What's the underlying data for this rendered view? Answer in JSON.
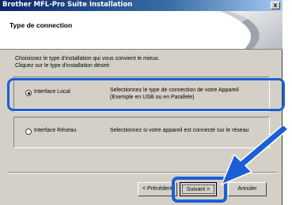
{
  "window": {
    "title": "Brother MFL-Pro Suite Installation",
    "close_glyph": "x"
  },
  "banner": {
    "heading": "Type de connection"
  },
  "instructions": {
    "line1": "Choisissez le type d'installation qui vous convient le mieux.",
    "line2": "Cliquez sur le type d'installation désiré."
  },
  "options": [
    {
      "label": "Interface Local",
      "selected": true,
      "desc_line1": "Selectionnez le type de connection de votre Appareil",
      "desc_line2": "(Exemple en USB ou en Parallele)"
    },
    {
      "label": "Interface Réseau",
      "selected": false,
      "desc_line1": "Selectionnez si votre appareil est connecté sur le réseau"
    }
  ],
  "buttons": {
    "prev": "< Précédent",
    "next": "Suivant >",
    "cancel": "Annuler"
  },
  "colors": {
    "highlight": "#1b5fd6",
    "arrow": "#1b5fd6"
  }
}
